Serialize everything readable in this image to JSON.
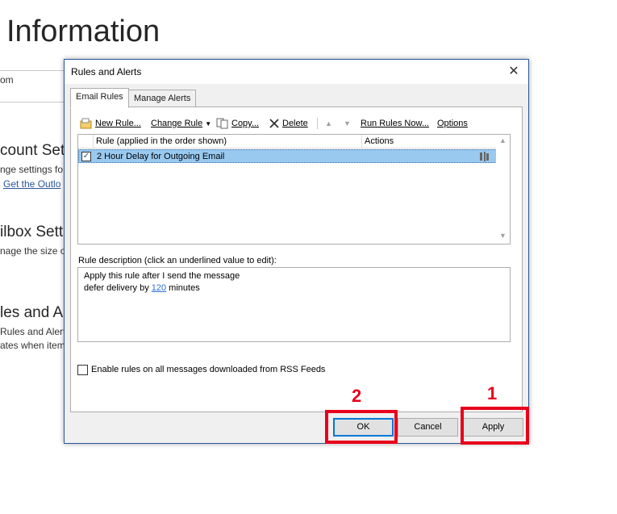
{
  "background": {
    "title": "Information",
    "account_text": "om",
    "sections": [
      {
        "heading": "count Set",
        "lines": [
          "nge settings fo"
        ],
        "link": "Get the Outlo"
      },
      {
        "heading": "ilbox Sett",
        "lines": [
          "nage the size of"
        ]
      },
      {
        "heading": "les and Al",
        "lines": [
          "Rules and Alert",
          "ates when item"
        ]
      }
    ]
  },
  "dialog": {
    "title": "Rules and Alerts",
    "close_glyph": "✕",
    "tabs": [
      {
        "label": "Email Rules",
        "active": true
      },
      {
        "label": "Manage Alerts",
        "active": false
      }
    ],
    "toolbar": {
      "new_rule": "New Rule...",
      "change_rule": "Change Rule",
      "copy": "Copy...",
      "delete": "Delete",
      "run_rules_now": "Run Rules Now...",
      "options": "Options"
    },
    "rules_list": {
      "columns": [
        "Rule (applied in the order shown)",
        "Actions"
      ],
      "rows": [
        {
          "checked": true,
          "name": "2 Hour Delay for Outgoing Email",
          "selected": true
        }
      ]
    },
    "description": {
      "label": "Rule description (click an underlined value to edit):",
      "line1": "Apply this rule after I send the message",
      "line2_prefix": "defer delivery by ",
      "line2_value": "120",
      "line2_suffix": " minutes"
    },
    "rss": {
      "checked": false,
      "label": "Enable rules on all messages downloaded from RSS Feeds"
    },
    "buttons": {
      "ok": "OK",
      "cancel": "Cancel",
      "apply": "Apply"
    }
  },
  "annotations": {
    "label_1": "1",
    "label_2": "2",
    "color": "#e8001c"
  },
  "colors": {
    "dialog_border": "#2b579a",
    "selected_row": "#99c9ef",
    "link": "#2b6fd6",
    "focus_border": "#0078d7"
  }
}
